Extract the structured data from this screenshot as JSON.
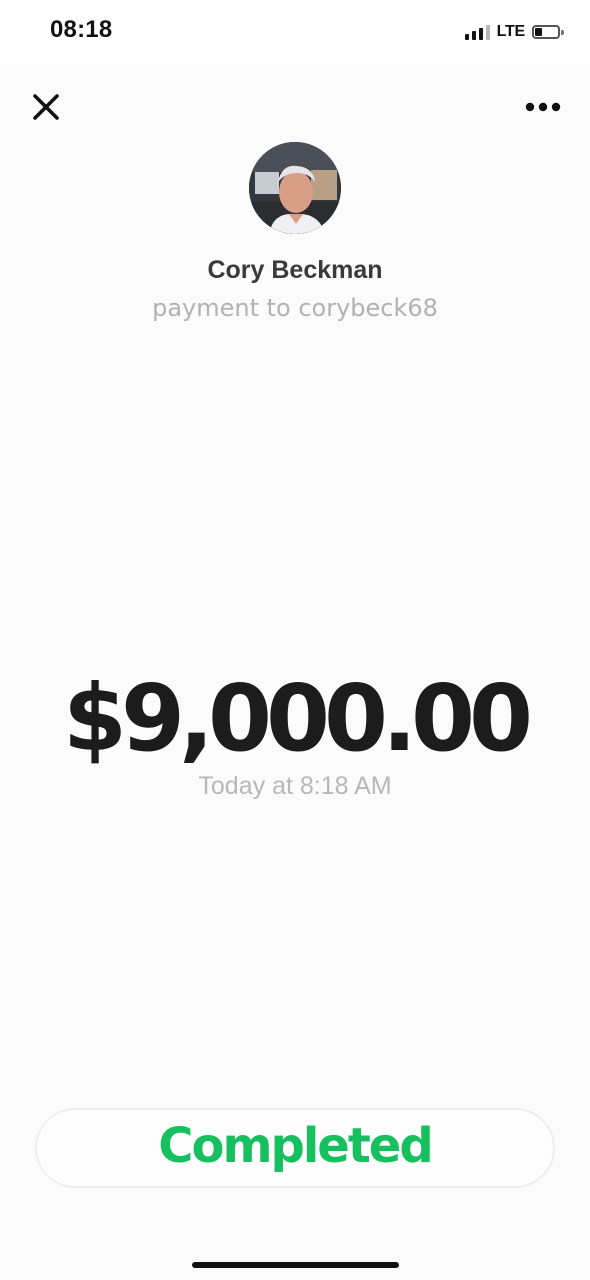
{
  "status_bar": {
    "time": "08:18",
    "network": "LTE",
    "signal_icon": "cellular-signal-icon",
    "battery_icon": "battery-icon",
    "battery_level": 0.3
  },
  "header": {
    "close_icon": "close-icon",
    "more_icon": "more-horizontal-icon"
  },
  "recipient": {
    "avatar": "profile-photo",
    "name": "Cory Beckman",
    "subtitle": "payment to corybeck68"
  },
  "payment": {
    "amount": "$9,000.00",
    "timestamp": "Today at 8:18 AM",
    "status": "Completed"
  },
  "colors": {
    "status_green": "#16c05f",
    "amount_text": "#1c1c1c",
    "secondary_text": "#b2b2b2"
  }
}
